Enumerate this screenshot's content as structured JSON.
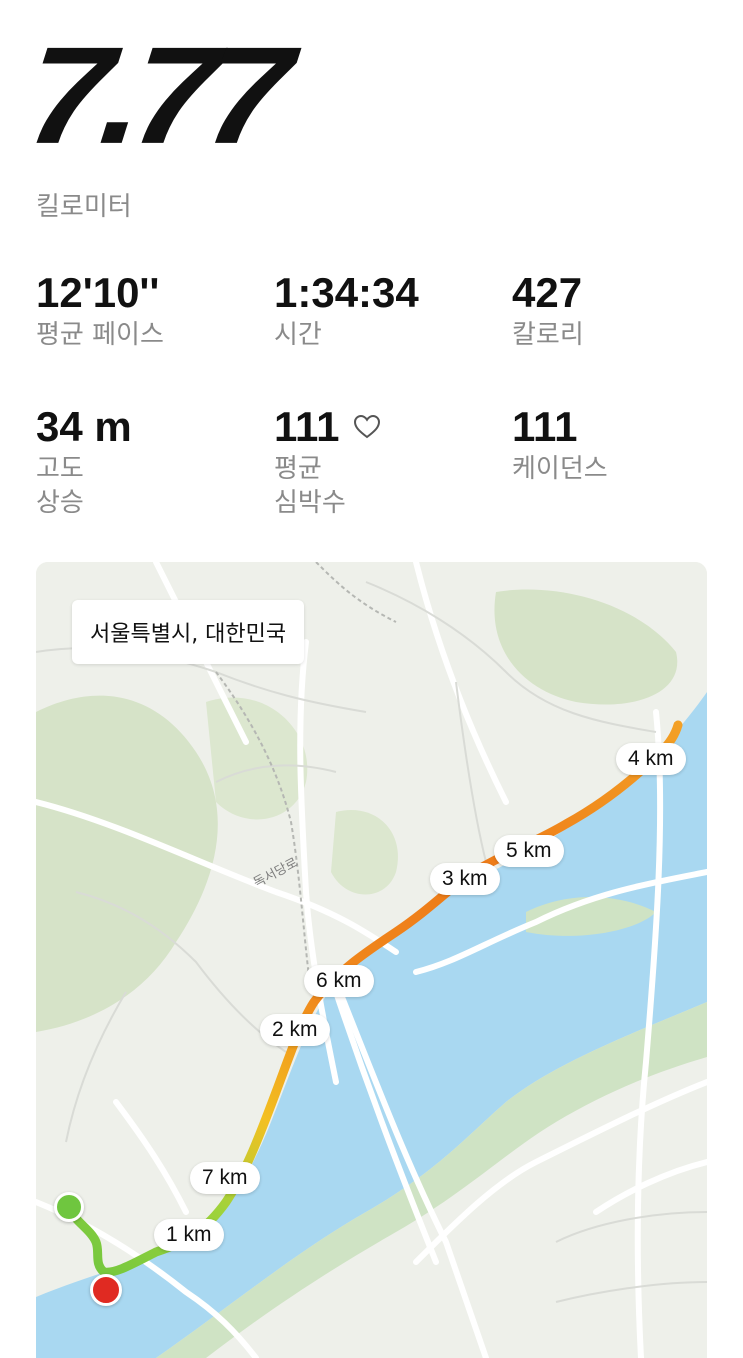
{
  "summary": {
    "distance": "7.77",
    "distance_unit": "킬로미터"
  },
  "stats": {
    "pace": {
      "value": "12'10''",
      "label": "평균 페이스"
    },
    "time": {
      "value": "1:34:34",
      "label": "시간"
    },
    "calories": {
      "value": "427",
      "label": "칼로리"
    },
    "elevation": {
      "value": "34 m",
      "label": "고도\n상승"
    },
    "heart_rate": {
      "value": "111",
      "label": "평균\n심박수",
      "icon": "heart-outline-icon"
    },
    "cadence": {
      "value": "111",
      "label": "케이던스"
    }
  },
  "map": {
    "location": "서울특별시, 대한민국",
    "road_label": "독서당로",
    "km_markers": [
      "1 km",
      "2 km",
      "3 km",
      "4 km",
      "5 km",
      "6 km",
      "7 km"
    ],
    "start_pin_color": "#6fc63f",
    "end_pin_color": "#e02a22",
    "water_color": "#a9d8f1",
    "green_color": "#d6e3c8"
  }
}
